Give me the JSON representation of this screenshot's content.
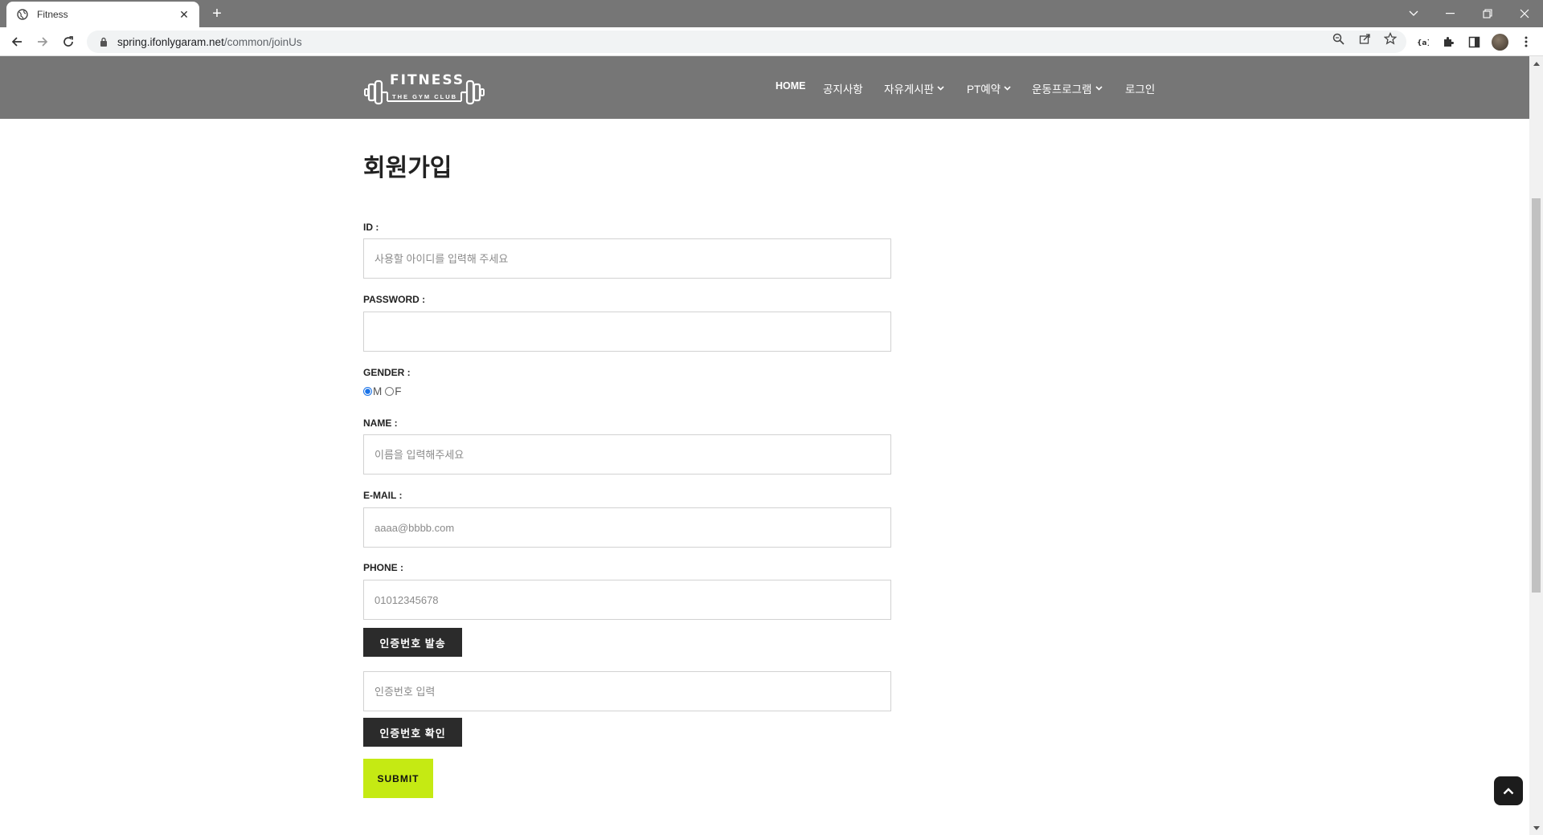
{
  "browser": {
    "tab_title": "Fitness",
    "new_tab": "+",
    "url_host": "spring.ifonlygaram.net",
    "url_path": "/common/joinUs"
  },
  "site": {
    "logo_text": "FITNESS",
    "logo_sub": "THE GYM CLUB",
    "nav": {
      "home": "HOME",
      "notice": "공지사항",
      "board": "자유게시판",
      "pt": "PT예약",
      "program": "운동프로그램",
      "login": "로그인"
    }
  },
  "form": {
    "title": "회원가입",
    "id_label": "ID :",
    "id_placeholder": "사용할 아이디를 입력해 주세요",
    "password_label": "PASSWORD :",
    "gender_label": "GENDER :",
    "gender_m": "M",
    "gender_f": "F",
    "gender_selected": "M",
    "name_label": "NAME :",
    "name_placeholder": "이름을 입력해주세요",
    "email_label": "E-MAIL :",
    "email_placeholder": "aaaa@bbbb.com",
    "phone_label": "PHONE :",
    "phone_placeholder": "01012345678",
    "send_code_button": "인증번호 발송",
    "code_placeholder": "인증번호 입력",
    "verify_code_button": "인증번호 확인",
    "submit_button": "SUBMIT"
  },
  "colors": {
    "header_bg": "#767676",
    "submit_bg": "#c5ea13",
    "dark_button": "#2b2b2b"
  }
}
